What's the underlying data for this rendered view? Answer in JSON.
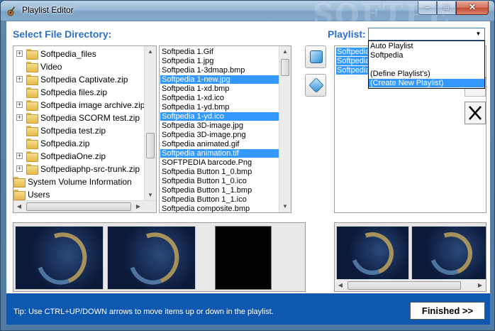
{
  "window": {
    "title": "Playlist Editor",
    "icon": "guitar-icon",
    "watermark": "SOFTPE",
    "min_glyph": "–",
    "max_glyph": "□",
    "close_glyph": "✕"
  },
  "directory": {
    "label": "Select File Directory:",
    "tree": [
      {
        "label": "Softpedia_files",
        "expander": "+",
        "indent": 1
      },
      {
        "label": "Video",
        "expander": "",
        "indent": 1
      },
      {
        "label": "Softpedia Captivate.zip",
        "expander": "+",
        "indent": 1
      },
      {
        "label": "Softpedia files.zip",
        "expander": "",
        "indent": 1
      },
      {
        "label": "Softpedia image archive.zip",
        "expander": "+",
        "indent": 1
      },
      {
        "label": "Softpedia SCORM test.zip",
        "expander": "+",
        "indent": 1
      },
      {
        "label": "Softpedia test.zip",
        "expander": "",
        "indent": 1
      },
      {
        "label": "Softpedia.zip",
        "expander": "",
        "indent": 1
      },
      {
        "label": "SoftpediaOne.zip",
        "expander": "+",
        "indent": 1
      },
      {
        "label": "Softpediaphp-src-trunk.zip",
        "expander": "+",
        "indent": 1
      },
      {
        "label": "System Volume Information",
        "expander": "",
        "indent": 0
      },
      {
        "label": "Users",
        "expander": "",
        "indent": 0
      }
    ]
  },
  "files": [
    {
      "name": "Softpedia 1.Gif",
      "selected": false
    },
    {
      "name": "Softpedia 1.jpg",
      "selected": false
    },
    {
      "name": "Softpedia 1-3dmap.bmp",
      "selected": false
    },
    {
      "name": "Softpedia 1-new.jpg",
      "selected": true
    },
    {
      "name": "Softpedia 1-xd.bmp",
      "selected": false
    },
    {
      "name": "Softpedia 1-xd.ico",
      "selected": false
    },
    {
      "name": "Softpedia 1-yd.bmp",
      "selected": false
    },
    {
      "name": "Softpedia 1-yd.ico",
      "selected": true
    },
    {
      "name": "Softpedia 3D-image.jpg",
      "selected": false
    },
    {
      "name": "Softpedia 3D-image.png",
      "selected": false
    },
    {
      "name": "Softpedia animated.gif",
      "selected": false
    },
    {
      "name": "Softpedia animation.tif",
      "selected": true
    },
    {
      "name": "SOFTPEDIA barcode.Png",
      "selected": false
    },
    {
      "name": "Softpedia Button 1_0.bmp",
      "selected": false
    },
    {
      "name": "Softpedia Button 1_0.ico",
      "selected": false
    },
    {
      "name": "Softpedia Button 1_1.bmp",
      "selected": false
    },
    {
      "name": "Softpedia Button 1_1.ico",
      "selected": false
    },
    {
      "name": "Softpedia composite.bmp",
      "selected": false
    }
  ],
  "playlist": {
    "label": "Playlist:",
    "selected_value": "",
    "options": [
      "Auto Playlist",
      "Softpedia",
      "",
      "(Define Playlist's)",
      "(Create New Playlist)"
    ],
    "highlighted_option": 4,
    "items": [
      "Softpedia",
      "Softpedia",
      "Softpedia"
    ]
  },
  "footer": {
    "tip": "Tip: Use CTRL+UP/DOWN arrows to move items up or down in the playlist.",
    "finished_label": "Finished >>"
  },
  "icons": {
    "add": "add-to-playlist-icon",
    "add_all": "add-all-icon",
    "delete": "delete-x-icon",
    "expander": "tree-expander-icon",
    "folder": "folder-icon"
  }
}
